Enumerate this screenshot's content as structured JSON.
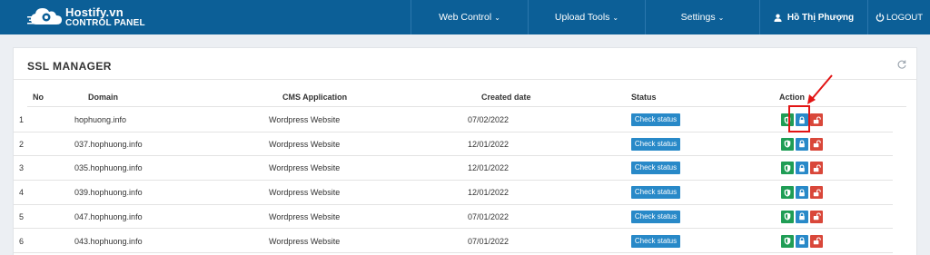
{
  "brand": {
    "name": "Hostify.vn",
    "subtitle": "CONTROL PANEL"
  },
  "nav": {
    "menus": [
      {
        "label": "Web Control"
      },
      {
        "label": "Upload Tools"
      },
      {
        "label": "Settings"
      }
    ],
    "user_name": "Hồ Thị Phượng",
    "logout_label": "LOGOUT"
  },
  "panel": {
    "title": "SSL MANAGER",
    "columns": {
      "no": "No",
      "domain": "Domain",
      "cms": "CMS Application",
      "created": "Created date",
      "status": "Status",
      "action": "Action"
    }
  },
  "rows": [
    {
      "no": "1",
      "domain": "hophuong.info",
      "cms": "Wordpress Website",
      "created": "07/02/2022",
      "status_button": "Check status"
    },
    {
      "no": "2",
      "domain": "037.hophuong.info",
      "cms": "Wordpress Website",
      "created": "12/01/2022",
      "status_button": "Check status"
    },
    {
      "no": "3",
      "domain": "035.hophuong.info",
      "cms": "Wordpress Website",
      "created": "12/01/2022",
      "status_button": "Check status"
    },
    {
      "no": "4",
      "domain": "039.hophuong.info",
      "cms": "Wordpress Website",
      "created": "12/01/2022",
      "status_button": "Check status"
    },
    {
      "no": "5",
      "domain": "047.hophuong.info",
      "cms": "Wordpress Website",
      "created": "07/01/2022",
      "status_button": "Check status"
    },
    {
      "no": "6",
      "domain": "043.hophuong.info",
      "cms": "Wordpress Website",
      "created": "07/01/2022",
      "status_button": "Check status"
    }
  ],
  "icons": {
    "logo": "cloud-logo-icon",
    "menu_chevron": "chevron-down-icon",
    "user": "user-icon",
    "logout": "power-icon",
    "refresh": "refresh-icon",
    "action_install": "shield-icon",
    "action_lock": "lock-icon",
    "action_unlock": "unlock-icon"
  },
  "colors": {
    "navbar": "#0c5f97",
    "status_button": "#2889c8",
    "action_green": "#1f9d55",
    "action_blue": "#2889c8",
    "action_red": "#d9473a",
    "annotation": "#e21414"
  }
}
